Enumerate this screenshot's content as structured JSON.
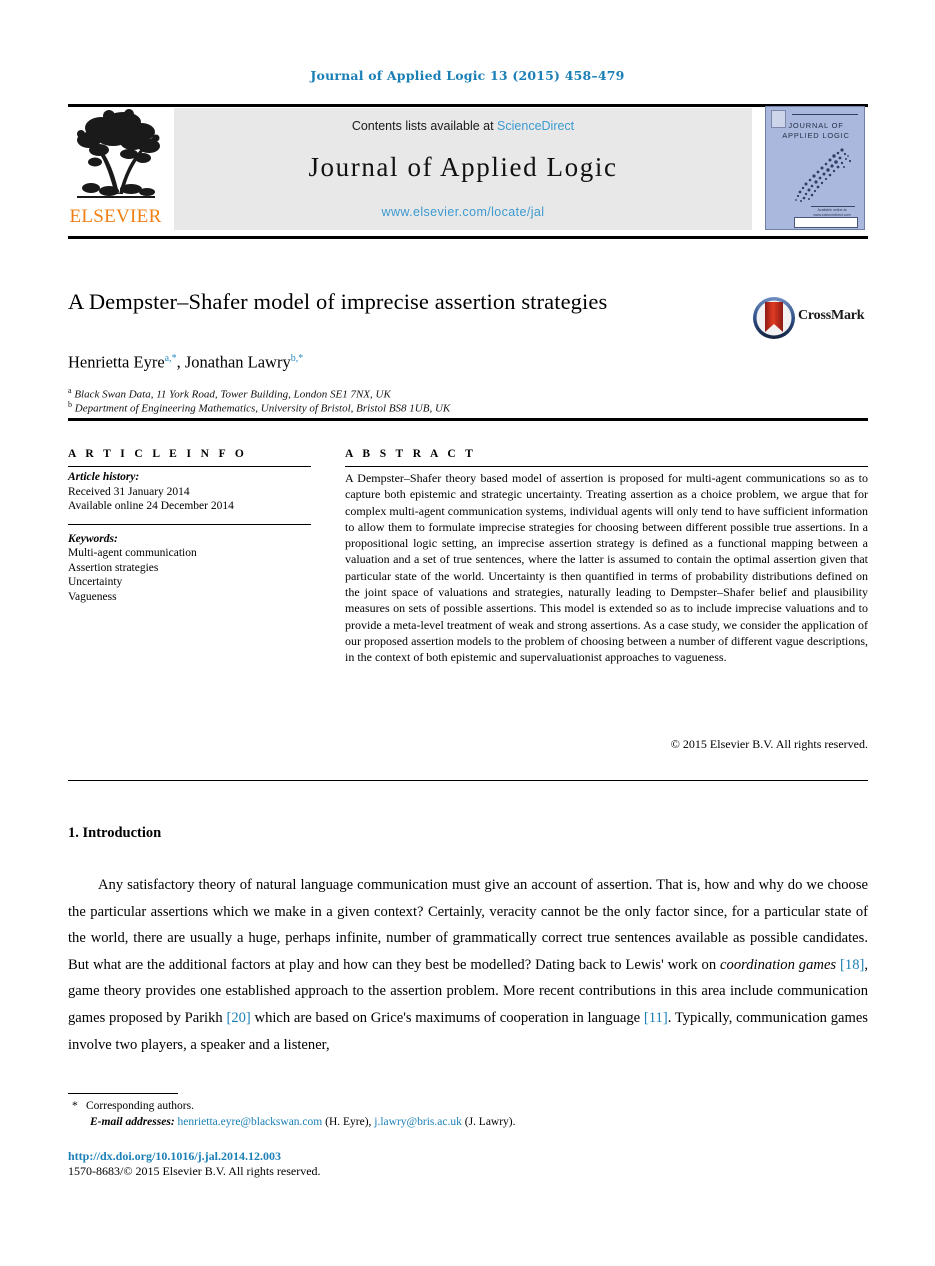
{
  "running_head": "Journal of Applied Logic 13 (2015) 458–479",
  "masthead": {
    "contents_prefix": "Contents lists available at ",
    "sciencedirect_link": "ScienceDirect",
    "journal_name": "Journal of Applied Logic",
    "journal_url": "www.elsevier.com/locate/jal",
    "publisher_wordmark": "ELSEVIER",
    "cover": {
      "title_line1": "JOURNAL OF",
      "title_line2": "APPLIED LOGIC",
      "footer_line1": "Available online at www.sciencedirect.com",
      "footer_line2": "ScienceDirect"
    }
  },
  "article": {
    "title": "A Dempster–Shafer model of imprecise assertion strategies",
    "authors": [
      {
        "name": "Henrietta Eyre",
        "affil_marker": "a",
        "corresponding": "*"
      },
      {
        "name": "Jonathan Lawry",
        "affil_marker": "b",
        "corresponding": "*"
      }
    ],
    "affiliations": [
      {
        "marker": "a",
        "text": "Black Swan Data, 11 York Road, Tower Building, London SE1 7NX, UK"
      },
      {
        "marker": "b",
        "text": "Department of Engineering Mathematics, University of Bristol, Bristol BS8 1UB, UK"
      }
    ],
    "crossmark_label": "CrossMark"
  },
  "info": {
    "heading": "A R T I C L E   I N F O",
    "history_label": "Article history:",
    "history": [
      "Received 31 January 2014",
      "Available online 24 December 2014"
    ],
    "keywords_label": "Keywords:",
    "keywords": [
      "Multi-agent communication",
      "Assertion strategies",
      "Uncertainty",
      "Vagueness"
    ]
  },
  "abstract": {
    "heading": "A B S T R A C T",
    "text": "A Dempster–Shafer theory based model of assertion is proposed for multi-agent communications so as to capture both epistemic and strategic uncertainty. Treating assertion as a choice problem, we argue that for complex multi-agent communication systems, individual agents will only tend to have sufficient information to allow them to formulate imprecise strategies for choosing between different possible true assertions. In a propositional logic setting, an imprecise assertion strategy is defined as a functional mapping between a valuation and a set of true sentences, where the latter is assumed to contain the optimal assertion given that particular state of the world. Uncertainty is then quantified in terms of probability distributions defined on the joint space of valuations and strategies, naturally leading to Dempster–Shafer belief and plausibility measures on sets of possible assertions. This model is extended so as to include imprecise valuations and to provide a meta-level treatment of weak and strong assertions. As a case study, we consider the application of our proposed assertion models to the problem of choosing between a number of different vague descriptions, in the context of both epistemic and supervaluationist approaches to vagueness.",
    "copyright": "© 2015 Elsevier B.V. All rights reserved."
  },
  "body": {
    "section_number_title": "1.  Introduction",
    "paragraph_1": {
      "part1": "Any satisfactory theory of natural language communication must give an account of assertion. That is, how and why do we choose the particular assertions which we make in a given context? Certainly, veracity cannot be the only factor since, for a particular state of the world, there are usually a huge, perhaps infinite, number of grammatically correct true sentences available as possible candidates. But what are the additional factors at play and how can they best be modelled? Dating back to Lewis' work on ",
      "italic1": "coordination games",
      "cite1": "[18]",
      "part2": ", game theory provides one established approach to the assertion problem. More recent contributions in this area include communication games proposed by Parikh ",
      "cite2": "[20]",
      "part3": " which are based on Grice's maximums of cooperation in language ",
      "cite3": "[11]",
      "part4": ". Typically, communication games involve two players, a speaker and a listener,"
    }
  },
  "footer": {
    "corresponding_star": "*",
    "corresponding_text": "Corresponding authors.",
    "email_label": "E-mail addresses:",
    "email1": "henrietta.eyre@blackswan.com",
    "email1_owner": "(H. Eyre),",
    "email2": "j.lawry@bris.ac.uk",
    "email2_owner": "(J. Lawry).",
    "doi": "http://dx.doi.org/10.1016/j.jal.2014.12.003",
    "issn_line": "1570-8683/© 2015 Elsevier B.V. All rights reserved."
  },
  "colors": {
    "link_blue": "#1a7fb5",
    "sciencedirect_blue": "#3d9ad1",
    "elsevier_orange": "#f07f13",
    "cover_blue": "#aab8dd",
    "contents_bg": "#e8e8e8"
  }
}
